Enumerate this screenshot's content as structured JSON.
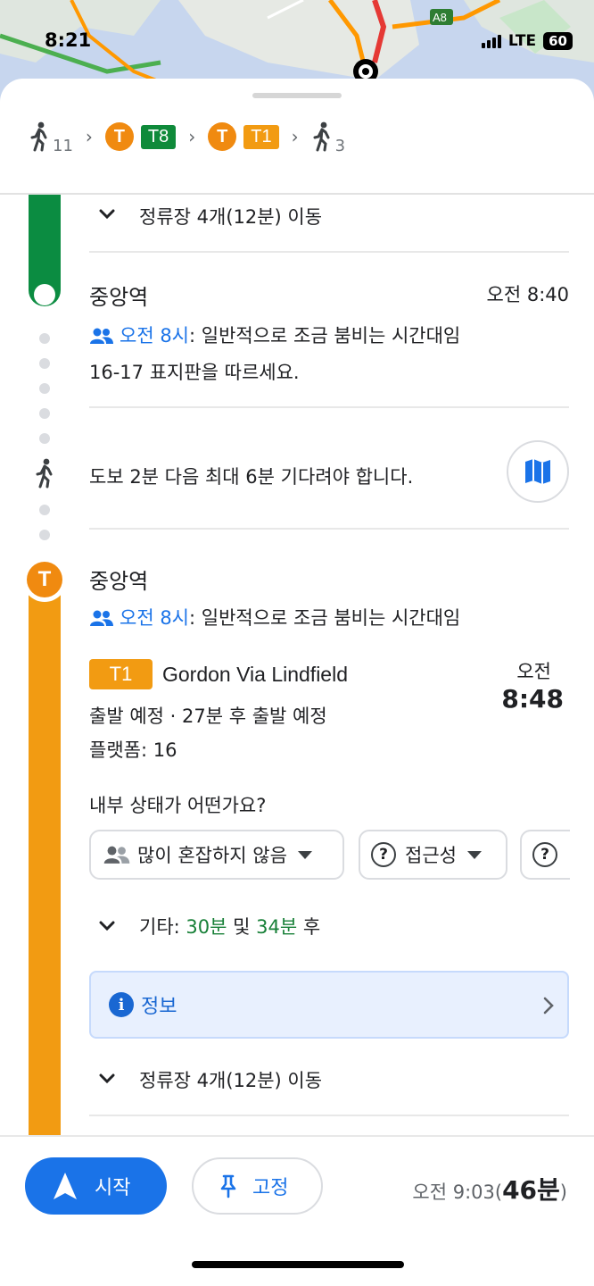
{
  "status_bar": {
    "time": "8:21",
    "network": "LTE",
    "battery": "60"
  },
  "map": {
    "road_label": "A8"
  },
  "route_summary": {
    "walk_start_minutes": "11",
    "leg1": {
      "mode": "T",
      "line": "T8",
      "color": "#0f8a3a"
    },
    "leg2": {
      "mode": "T",
      "line": "T1",
      "color": "#f29b12"
    },
    "walk_end_minutes": "3"
  },
  "segments": {
    "stops_collapsed_top": "정류장 4개(12분) 이동",
    "arrival_station": {
      "name": "중앙역",
      "time": "오전 8:40",
      "crowd_time": "오전 8시",
      "crowd_text": ": 일반적으로 조금 붐비는 시간대임",
      "instruction": "16-17 표지판을 따르세요."
    },
    "transfer": {
      "text": "도보 2분 다음 최대 6분 기다려야 합니다."
    },
    "departure_station": {
      "name": "중앙역",
      "crowd_time": "오전 8시",
      "crowd_text": ": 일반적으로 조금 붐비는 시간대임",
      "line_badge": "T1",
      "destination": "Gordon Via Lindfield",
      "status": "출발 예정 · 27분 후 출발 예정",
      "platform": "플랫폼: 16",
      "dep_label": "오전",
      "dep_time": "8:48",
      "question": "내부 상태가 어떤가요?",
      "chips": [
        "많이 혼잡하지 않음",
        "접근성",
        "?"
      ],
      "others_prefix": "기타: ",
      "others_first": "30분",
      "others_mid": " 및 ",
      "others_second": "34분",
      "others_suffix": " 후",
      "info_label": "정보",
      "stops_collapsed_bottom": "정류장 4개(12분) 이동"
    }
  },
  "bottom_bar": {
    "start_label": "시작",
    "pin_label": "고정",
    "arrival_prefix": "오전 9:03(",
    "duration": "46분",
    "arrival_suffix": ")"
  },
  "colors": {
    "accent": "#1a73e8",
    "t8_green": "#0b8c41",
    "t1_orange": "#f29b12",
    "sydney_trains": "#f08a10"
  }
}
